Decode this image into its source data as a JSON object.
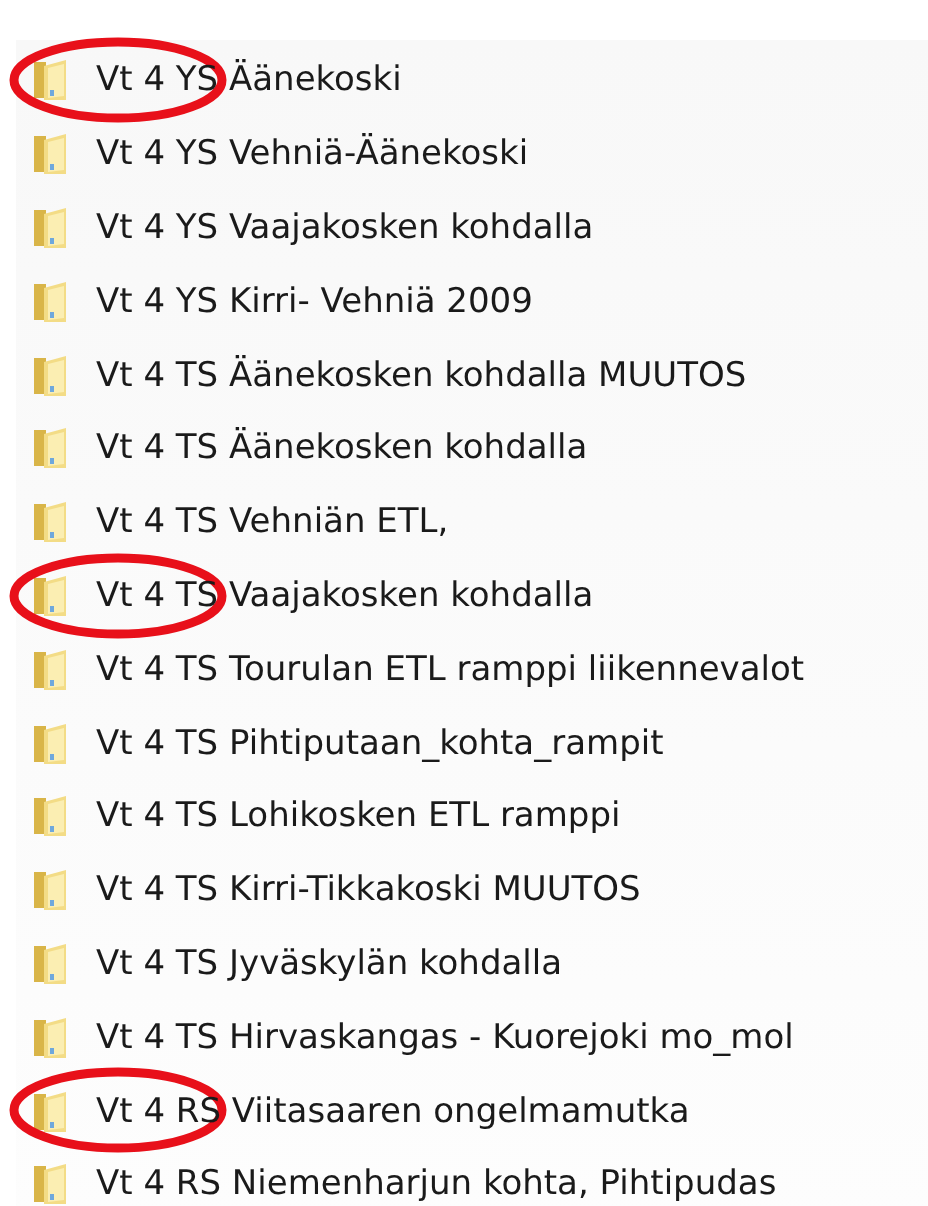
{
  "folders": [
    {
      "name": "Vt 4 YS Äänekoski",
      "circled": true
    },
    {
      "name": "Vt 4 YS Vehniä-Äänekoski",
      "circled": false
    },
    {
      "name": "Vt 4 YS Vaajakosken kohdalla",
      "circled": false
    },
    {
      "name": "Vt 4 YS Kirri- Vehniä 2009",
      "circled": false
    },
    {
      "name": "Vt 4 TS Äänekosken kohdalla MUUTOS",
      "circled": false
    },
    {
      "name": "Vt 4 TS Äänekosken kohdalla",
      "circled": false
    },
    {
      "name": "Vt 4 TS Vehniän ETL,",
      "circled": false
    },
    {
      "name": "Vt 4 TS Vaajakosken kohdalla",
      "circled": true
    },
    {
      "name": "Vt 4 TS Tourulan ETL ramppi liikennevalot",
      "circled": false
    },
    {
      "name": "Vt 4 TS Pihtiputaan_kohta_rampit",
      "circled": false
    },
    {
      "name": "Vt 4 TS Lohikosken ETL ramppi",
      "circled": false
    },
    {
      "name": "Vt 4 TS Kirri-Tikkakoski MUUTOS",
      "circled": false
    },
    {
      "name": "Vt 4 TS Jyväskylän kohdalla",
      "circled": false
    },
    {
      "name": "Vt 4 TS Hirvaskangas - Kuorejoki mo_mol",
      "circled": false
    },
    {
      "name": "Vt 4 RS Viitasaaren ongelmamutka",
      "circled": true
    },
    {
      "name": "Vt 4 RS Niemenharjun kohta, Pihtipudas",
      "circled": false
    }
  ]
}
